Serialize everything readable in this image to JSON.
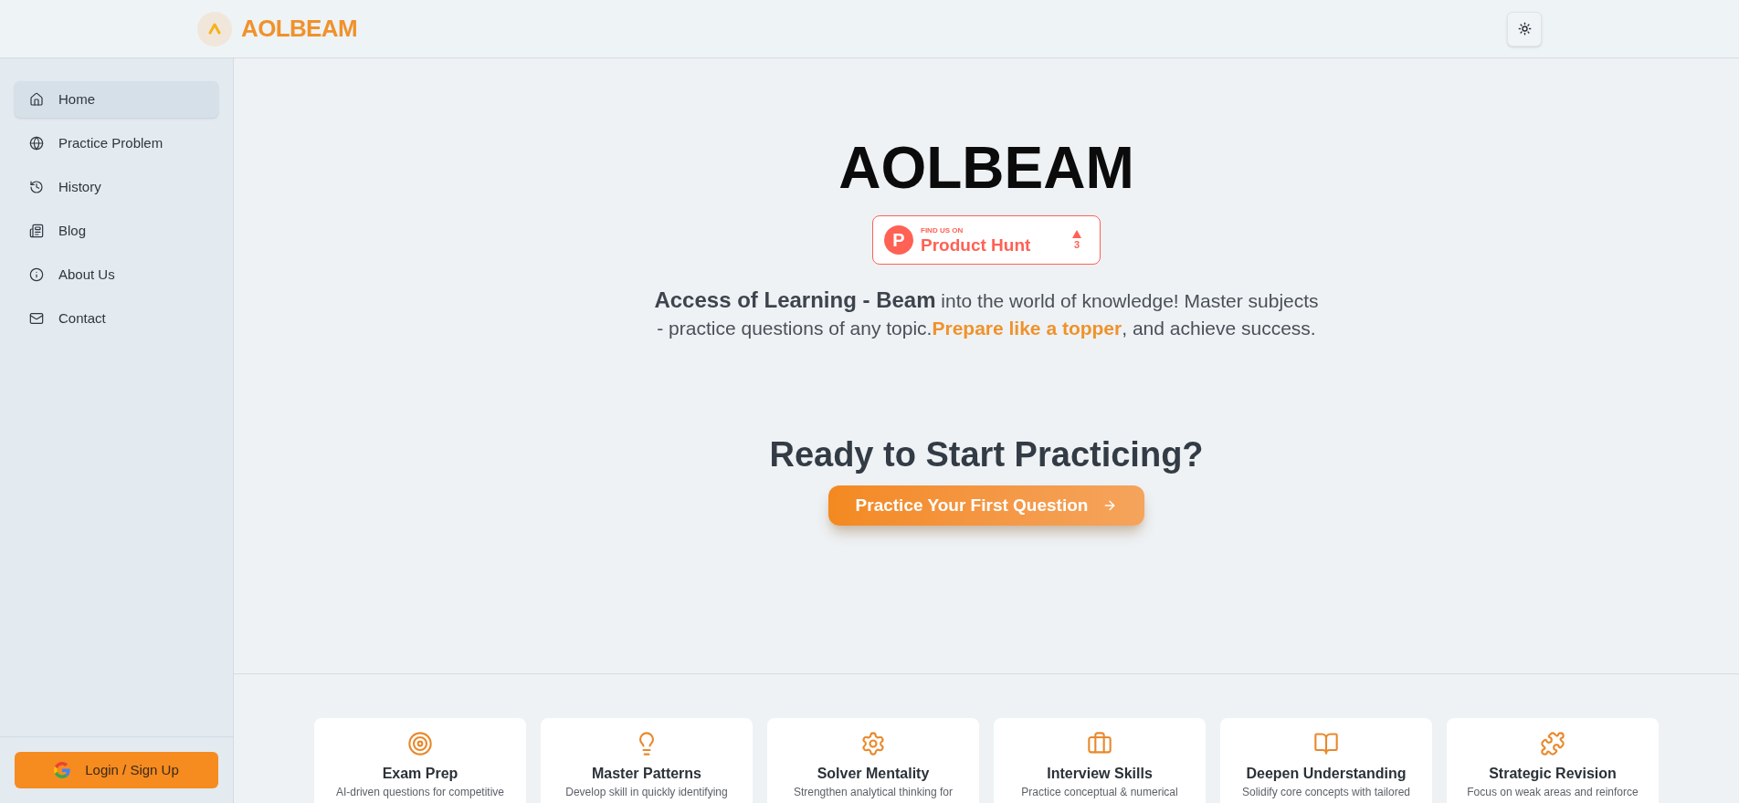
{
  "header": {
    "brand": "AOLBEAM"
  },
  "sidebar": {
    "items": [
      {
        "label": "Home",
        "selected": true
      },
      {
        "label": "Practice Problem",
        "selected": false
      },
      {
        "label": "History",
        "selected": false
      },
      {
        "label": "Blog",
        "selected": false
      },
      {
        "label": "About Us",
        "selected": false
      },
      {
        "label": "Contact",
        "selected": false
      }
    ],
    "login_button": {
      "label": "Login / Sign Up"
    }
  },
  "hero": {
    "title": "AOLBEAM",
    "badge": {
      "logo_letter": "P",
      "eyebrow": "FIND US ON",
      "name": "Product Hunt",
      "upvotes": "3"
    },
    "tagline": [
      {
        "kind": "strong",
        "text": "Access of Learning - Beam"
      },
      {
        "kind": "plain",
        "text": " into the world of knowledge! Master subjects - practice questions of any topic."
      },
      {
        "kind": "highlight",
        "text": "Prepare like a topper"
      },
      {
        "kind": "plain",
        "text": ", and achieve success."
      }
    ]
  },
  "cta": {
    "heading": "Ready to Start Practicing?",
    "button": {
      "label": "Practice Your First Question"
    }
  },
  "features": [
    {
      "title": "Exam Prep",
      "description": "AI-driven questions for competitive"
    },
    {
      "title": "Master Patterns",
      "description": "Develop skill in quickly identifying"
    },
    {
      "title": "Solver Mentality",
      "description": "Strengthen analytical thinking for"
    },
    {
      "title": "Interview Skills",
      "description": "Practice conceptual & numerical"
    },
    {
      "title": "Deepen Understanding",
      "description": "Solidify core concepts with tailored"
    },
    {
      "title": "Strategic Revision",
      "description": "Focus on weak areas and reinforce"
    }
  ]
}
